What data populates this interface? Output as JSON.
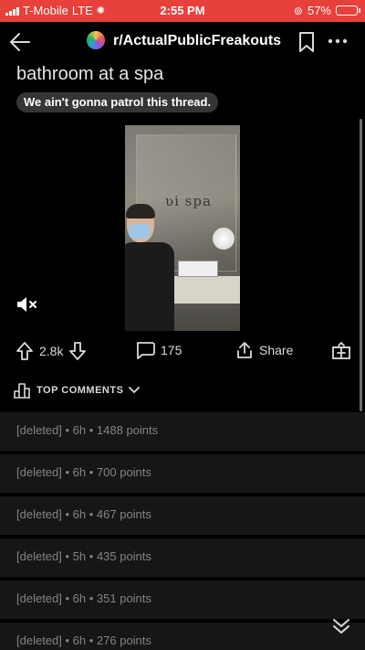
{
  "status_bar": {
    "carrier": "T-Mobile",
    "network": "LTE",
    "time": "2:55 PM",
    "battery": "57%",
    "battery_level": 0.57
  },
  "nav": {
    "subreddit": "r/ActualPublicFreakouts",
    "back_icon": "arrow-left-icon",
    "bookmark_icon": "bookmark-icon",
    "more_icon": "more-horizontal-icon"
  },
  "post": {
    "title": "bathroom at a spa",
    "flair": "We ain't gonna patrol this thread."
  },
  "actions": {
    "upvotes": "2.8k",
    "comments": "175",
    "share": "Share"
  },
  "comments_header": {
    "label": "TOP COMMENTS"
  },
  "comments": [
    {
      "author": "[deleted]",
      "age": "6h",
      "points": "1488 points"
    },
    {
      "author": "[deleted]",
      "age": "6h",
      "points": "700 points"
    },
    {
      "author": "[deleted]",
      "age": "6h",
      "points": "467 points"
    },
    {
      "author": "[deleted]",
      "age": "5h",
      "points": "435 points"
    },
    {
      "author": "[deleted]",
      "age": "6h",
      "points": "351 points"
    },
    {
      "author": "[deleted]",
      "age": "6h",
      "points": "276 points"
    }
  ],
  "colors": {
    "status_bar": "#e8403a",
    "background": "#000000",
    "row_background": "#161617",
    "muted_text": "#818384"
  }
}
